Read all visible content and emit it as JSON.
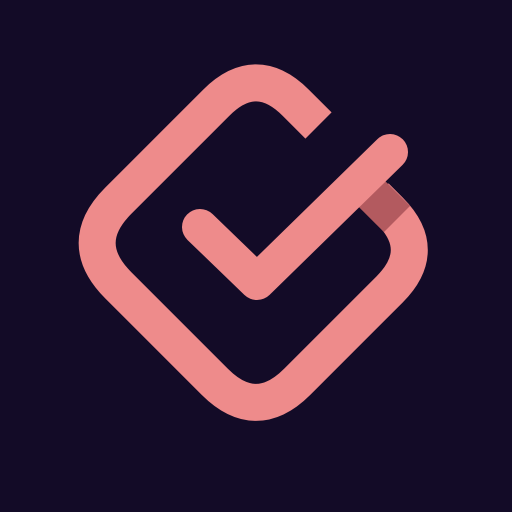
{
  "app_icon": {
    "icon": "checkmark-in-rounded-diamond-icon",
    "colors": {
      "background": "#130b27",
      "mark": "#ee8b8b",
      "overlap_shadow": "#b35a5f"
    }
  }
}
